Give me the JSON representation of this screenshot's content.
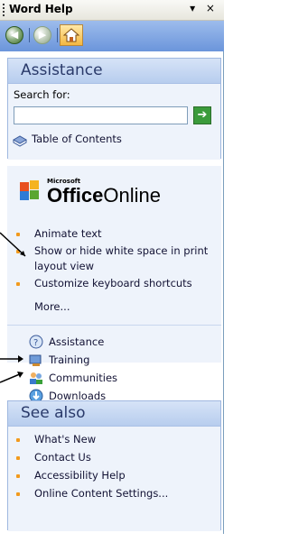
{
  "titlebar": {
    "title": "Word Help",
    "controls": "▾ ×"
  },
  "nav": {
    "back_icon": "back-arrow-icon",
    "forward_icon": "forward-arrow-icon",
    "home_icon": "home-icon"
  },
  "assistance": {
    "heading": "Assistance",
    "search_label": "Search for:",
    "search_value": "",
    "go_icon": "green-arrow-icon",
    "toc_label": "Table of Contents"
  },
  "office_online": {
    "microsoft": "Microsoft",
    "office": "Office",
    "online": "Online"
  },
  "links": [
    "Animate text",
    "Show or hide white space in print layout view",
    "Customize keyboard shortcuts"
  ],
  "more_label": "More...",
  "resources": [
    {
      "label": "Assistance",
      "icon": "assistance-icon"
    },
    {
      "label": "Training",
      "icon": "training-icon"
    },
    {
      "label": "Communities",
      "icon": "communities-icon"
    },
    {
      "label": "Downloads",
      "icon": "downloads-icon"
    }
  ],
  "see_also": {
    "heading": "See also",
    "items": [
      "What's New",
      "Contact Us",
      "Accessibility Help",
      "Online Content Settings..."
    ]
  },
  "colors": {
    "accent_orange": "#f29a1d",
    "header_blue": "#b7cdee",
    "nav_blue": "#6b95db"
  }
}
